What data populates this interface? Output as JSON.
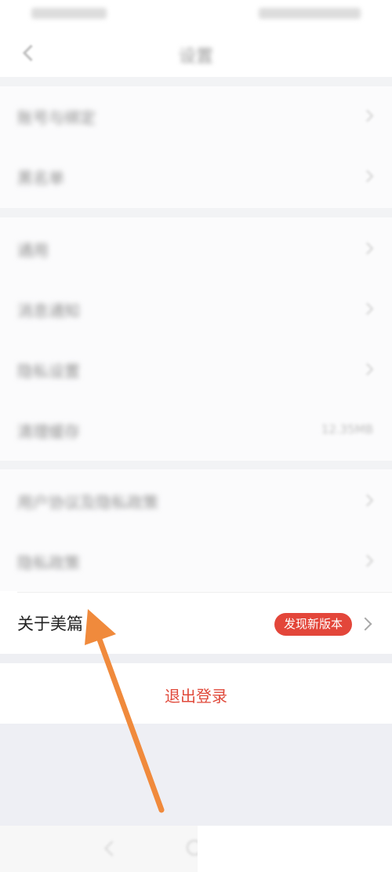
{
  "nav": {
    "title": "设置"
  },
  "section1": [
    {
      "label": "账号与绑定"
    },
    {
      "label": "黑名单"
    }
  ],
  "section2": [
    {
      "label": "通用"
    },
    {
      "label": "消息通知"
    },
    {
      "label": "隐私设置"
    },
    {
      "label": "清理缓存",
      "value": "12.35MB"
    }
  ],
  "section3": [
    {
      "label": "用户协议及隐私政策"
    },
    {
      "label": "隐私政策"
    }
  ],
  "about": {
    "label": "关于美篇",
    "badge": "发现新版本"
  },
  "logout": {
    "label": "退出登录"
  },
  "colors": {
    "accent": "#e3463a",
    "logout_text": "#e04a3b",
    "annotation_arrow": "#f08a3c"
  }
}
